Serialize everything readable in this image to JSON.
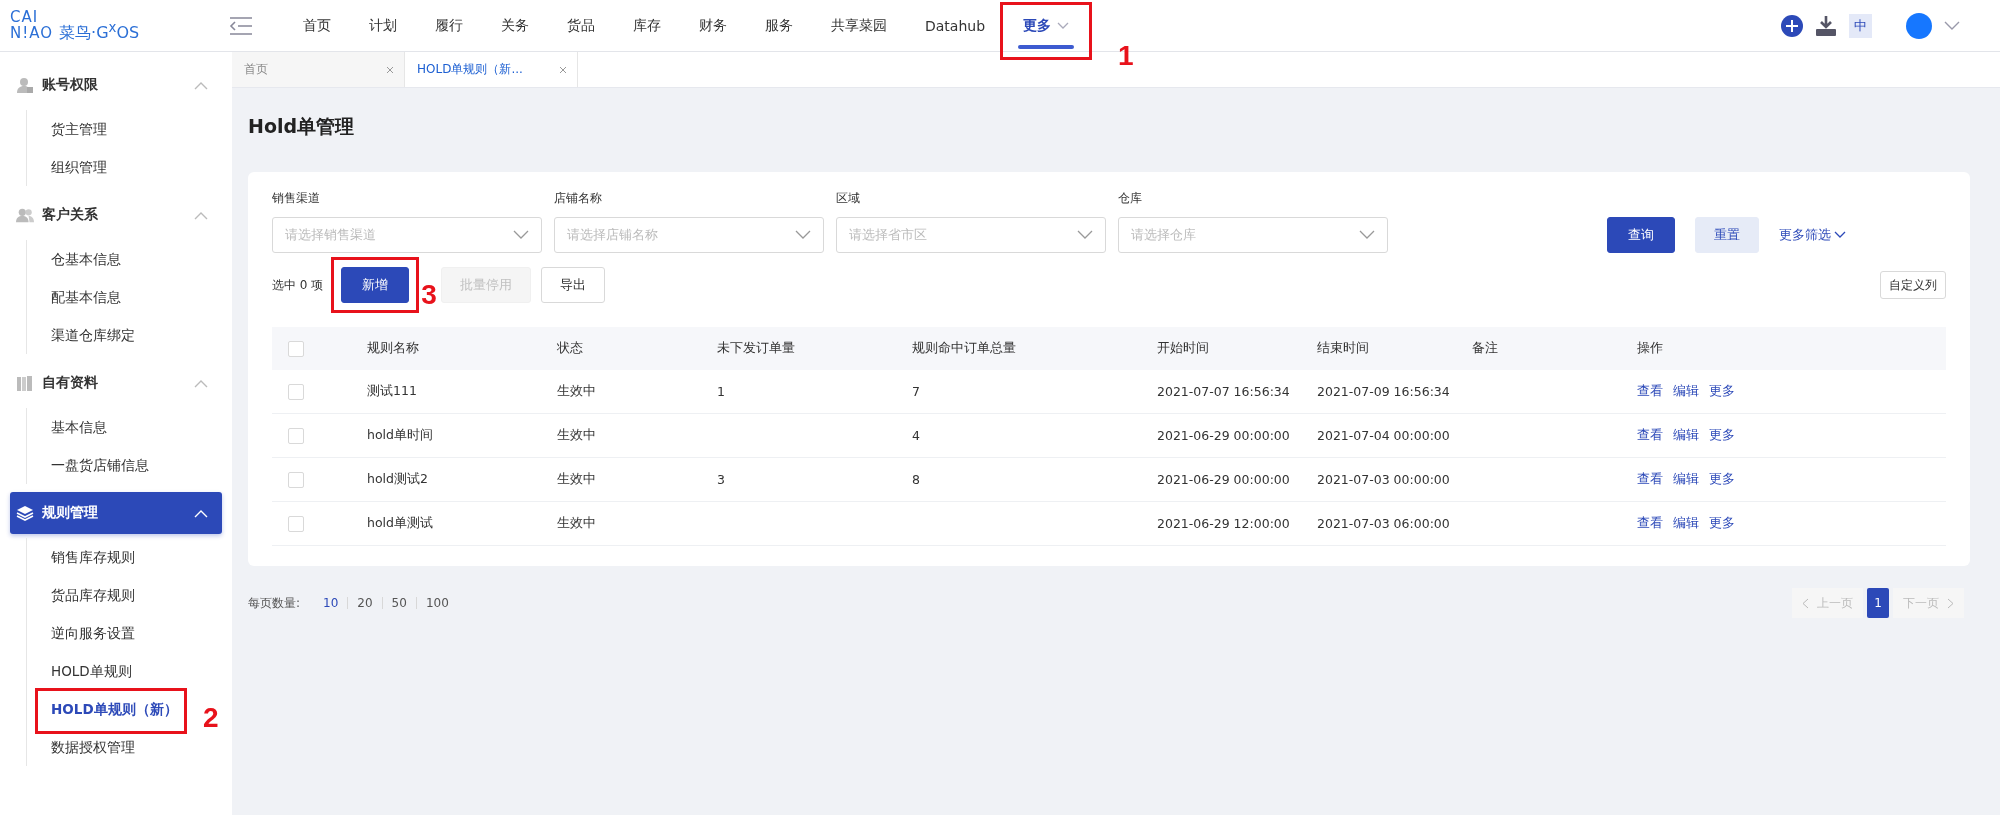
{
  "logo": {
    "line1": "CAI",
    "line2": "N!AO",
    "brand": "菜鸟·G$^{x}$OS"
  },
  "nav": [
    {
      "label": "首页",
      "selected": false
    },
    {
      "label": "计划",
      "selected": false
    },
    {
      "label": "履行",
      "selected": false
    },
    {
      "label": "关务",
      "selected": false
    },
    {
      "label": "货品",
      "selected": false
    },
    {
      "label": "库存",
      "selected": false
    },
    {
      "label": "财务",
      "selected": false
    },
    {
      "label": "服务",
      "selected": false
    },
    {
      "label": "共享菜园",
      "selected": false
    },
    {
      "label": "Datahub",
      "selected": false
    },
    {
      "label": "更多",
      "selected": true,
      "callout": "1"
    }
  ],
  "language": "中",
  "tabs": [
    {
      "label": "首页",
      "selected": false
    },
    {
      "label": "HOLD单规则（新...",
      "selected": true
    }
  ],
  "sidebar": [
    {
      "label": "账号权限",
      "expanded": true,
      "selected": false,
      "children": [
        {
          "label": "货主管理",
          "selected": false
        },
        {
          "label": "组织管理",
          "selected": false
        }
      ]
    },
    {
      "label": "客户关系",
      "expanded": true,
      "selected": false,
      "children": [
        {
          "label": "仓基本信息",
          "selected": false
        },
        {
          "label": "配基本信息",
          "selected": false
        },
        {
          "label": "渠道仓库绑定",
          "selected": false
        }
      ]
    },
    {
      "label": "自有资料",
      "expanded": true,
      "selected": false,
      "children": [
        {
          "label": "基本信息",
          "selected": false
        },
        {
          "label": "一盘货店铺信息",
          "selected": false
        }
      ]
    },
    {
      "label": "规则管理",
      "expanded": true,
      "selected": true,
      "children": [
        {
          "label": "销售库存规则",
          "selected": false
        },
        {
          "label": "货品库存规则",
          "selected": false
        },
        {
          "label": "逆向服务设置",
          "selected": false
        },
        {
          "label": "HOLD单规则",
          "selected": false
        },
        {
          "label": "HOLD单规则（新）",
          "selected": true,
          "callout": "2"
        },
        {
          "label": "数据授权管理",
          "selected": false
        }
      ]
    }
  ],
  "page_title": "Hold单管理",
  "filters": [
    {
      "label": "销售渠道",
      "placeholder": "请选择销售渠道"
    },
    {
      "label": "店铺名称",
      "placeholder": "请选择店铺名称"
    },
    {
      "label": "区域",
      "placeholder": "请选择省市区"
    },
    {
      "label": "仓库",
      "placeholder": "请选择仓库"
    }
  ],
  "query_button": "查询",
  "reset_button": "重置",
  "more_filters": "更多筛选",
  "selected_count": "选中 0 项",
  "actions": [
    {
      "label": "新增",
      "kind": "primary",
      "disabled": false,
      "callout": "3"
    },
    {
      "label": "批量停用",
      "kind": "normal",
      "disabled": true
    },
    {
      "label": "导出",
      "kind": "normal",
      "disabled": false
    }
  ],
  "custom_columns": "自定义列",
  "table": {
    "all_checked": false,
    "columns": [
      "规则名称",
      "状态",
      "未下发订单量",
      "规则命中订单总量",
      "开始时间",
      "结束时间",
      "备注",
      "操作"
    ],
    "rows": [
      {
        "checked": false,
        "cells": [
          "测试111",
          "生效中",
          "1",
          "7",
          "2021-07-07 16:56:34",
          "2021-07-09 16:56:34",
          ""
        ],
        "links": [
          "查看",
          "编辑",
          "更多"
        ]
      },
      {
        "checked": false,
        "cells": [
          "hold单时间",
          "生效中",
          "",
          "4",
          "2021-06-29 00:00:00",
          "2021-07-04 00:00:00",
          ""
        ],
        "links": [
          "查看",
          "编辑",
          "更多"
        ]
      },
      {
        "checked": false,
        "cells": [
          "hold测试2",
          "生效中",
          "3",
          "8",
          "2021-06-29 00:00:00",
          "2021-07-03 00:00:00",
          ""
        ],
        "links": [
          "查看",
          "编辑",
          "更多"
        ]
      },
      {
        "checked": false,
        "cells": [
          "hold单测试",
          "生效中",
          "",
          "",
          "2021-06-29 12:00:00",
          "2021-07-03 06:00:00",
          ""
        ],
        "links": [
          "查看",
          "编辑",
          "更多"
        ]
      }
    ]
  },
  "page_size_label": "每页数量:",
  "page_sizes": [
    {
      "label": "10",
      "selected": true
    },
    {
      "label": "20",
      "selected": false
    },
    {
      "label": "50",
      "selected": false
    },
    {
      "label": "100",
      "selected": false
    }
  ],
  "pagination": {
    "prev": "上一页",
    "next": "下一页",
    "pages": [
      {
        "label": "1",
        "selected": true
      }
    ],
    "prev_disabled": true,
    "next_disabled": true
  }
}
